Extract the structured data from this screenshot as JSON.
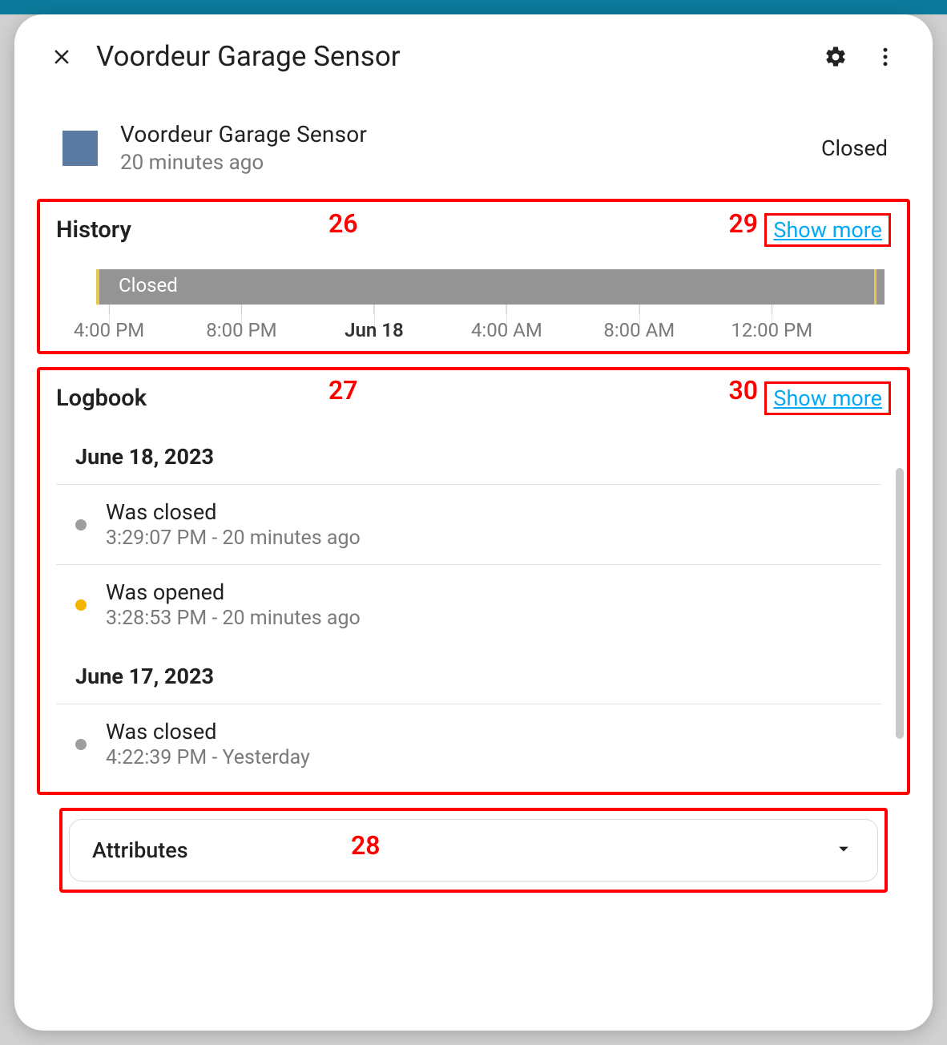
{
  "header": {
    "title": "Voordeur Garage Sensor"
  },
  "status": {
    "name": "Voordeur Garage Sensor",
    "updated": "20 minutes ago",
    "state": "Closed"
  },
  "sections": {
    "history_label": "History",
    "logbook_label": "Logbook",
    "attributes_label": "Attributes",
    "show_more": "Show more"
  },
  "history": {
    "bar_label": "Closed",
    "ticks": [
      {
        "label": "4:00 PM",
        "pos": 6,
        "bold": false
      },
      {
        "label": "8:00 PM",
        "pos": 22,
        "bold": false
      },
      {
        "label": "Jun 18",
        "pos": 38,
        "bold": true
      },
      {
        "label": "4:00 AM",
        "pos": 54,
        "bold": false
      },
      {
        "label": "8:00 AM",
        "pos": 70,
        "bold": false
      },
      {
        "label": "12:00 PM",
        "pos": 86,
        "bold": false
      }
    ]
  },
  "logbook": {
    "groups": [
      {
        "date": "June 18, 2023",
        "entries": [
          {
            "title": "Was closed",
            "sub": "3:29:07 PM - 20 minutes ago",
            "kind": "closed"
          },
          {
            "title": "Was opened",
            "sub": "3:28:53 PM - 20 minutes ago",
            "kind": "open"
          }
        ]
      },
      {
        "date": "June 17, 2023",
        "entries": [
          {
            "title": "Was closed",
            "sub": "4:22:39 PM - Yesterday",
            "kind": "closed"
          }
        ]
      }
    ]
  },
  "annotations": {
    "n26": "26",
    "n27": "27",
    "n28": "28",
    "n29": "29",
    "n30": "30"
  }
}
